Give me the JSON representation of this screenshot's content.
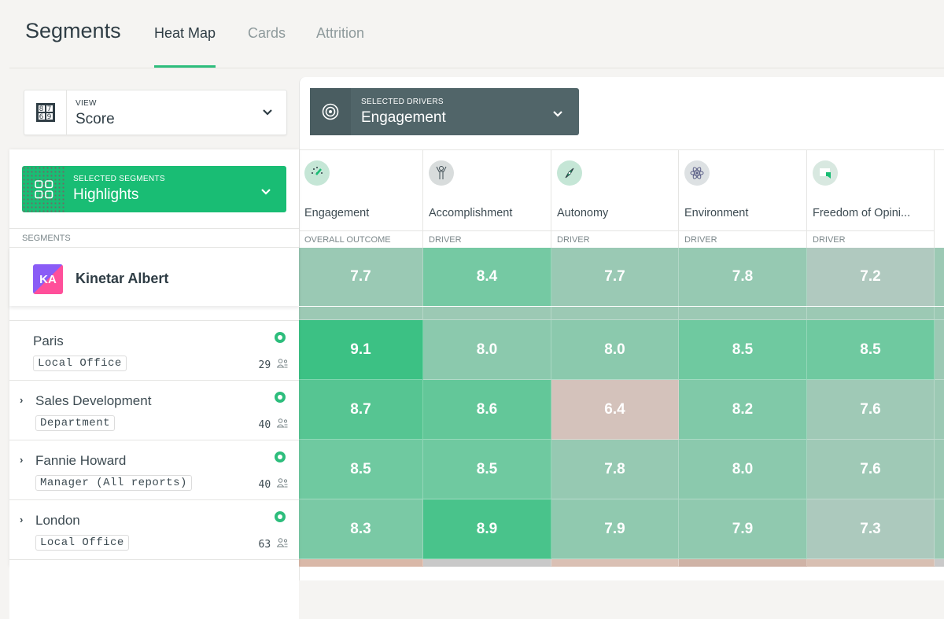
{
  "header": {
    "title": "Segments",
    "tabs": [
      {
        "label": "Heat Map",
        "active": true
      },
      {
        "label": "Cards",
        "active": false
      },
      {
        "label": "Attrition",
        "active": false
      }
    ],
    "accent_color": "#2dbd7c"
  },
  "view_select": {
    "label": "VIEW",
    "value": "Score",
    "icon": "score-grid-icon",
    "icon_digits": [
      "8",
      "7",
      "6",
      "9"
    ]
  },
  "drivers_select": {
    "label": "SELECTED DRIVERS",
    "value": "Engagement",
    "icon": "target-icon"
  },
  "segments_select": {
    "label": "SELECTED SEGMENTS",
    "value": "Highlights",
    "icon": "grid-icon"
  },
  "segments_header": "SEGMENTS",
  "columns": [
    {
      "name": "Engagement",
      "type": "OVERALL OUTCOME",
      "icon": "gauge-icon"
    },
    {
      "name": "Accomplishment",
      "type": "DRIVER",
      "icon": "person-arms-up-icon"
    },
    {
      "name": "Autonomy",
      "type": "DRIVER",
      "icon": "compass-icon"
    },
    {
      "name": "Environment",
      "type": "DRIVER",
      "icon": "atom-icon"
    },
    {
      "name": "Freedom of Opini...",
      "type": "DRIVER",
      "icon": "speech-bubble-icon"
    }
  ],
  "company_row": {
    "initials": "KA",
    "name": "Kinetar Albert",
    "scores": [
      "7.7",
      "8.4",
      "7.7",
      "7.8",
      "7.2"
    ]
  },
  "segments": [
    {
      "name": "Paris",
      "tag": "Local Office",
      "count": "29",
      "expandable": false,
      "scores": [
        "9.1",
        "8.0",
        "8.0",
        "8.5",
        "8.5"
      ]
    },
    {
      "name": "Sales Development",
      "tag": "Department",
      "count": "40",
      "expandable": true,
      "scores": [
        "8.7",
        "8.6",
        "6.4",
        "8.2",
        "7.6"
      ]
    },
    {
      "name": "Fannie Howard",
      "tag": "Manager (All reports)",
      "count": "40",
      "expandable": true,
      "scores": [
        "8.5",
        "8.5",
        "7.8",
        "8.0",
        "7.6"
      ]
    },
    {
      "name": "London",
      "tag": "Local Office",
      "count": "63",
      "expandable": true,
      "scores": [
        "8.3",
        "8.9",
        "7.9",
        "7.9",
        "7.3"
      ]
    }
  ]
}
